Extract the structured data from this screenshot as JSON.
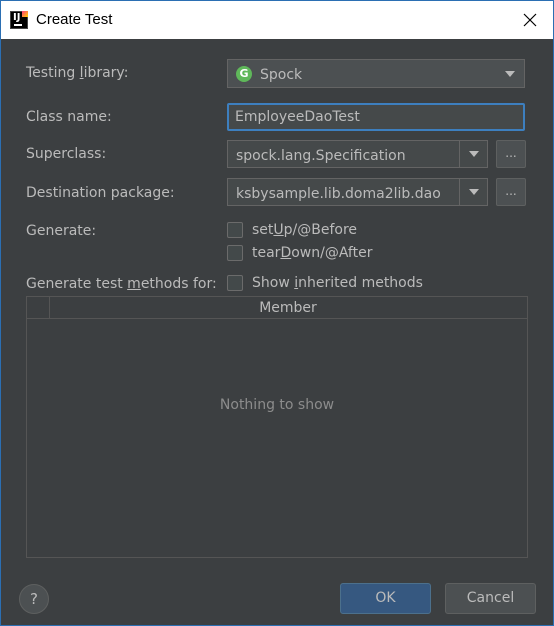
{
  "window": {
    "title": "Create Test"
  },
  "labels": {
    "testing_library_pre": "Testing ",
    "testing_library_u": "l",
    "testing_library_post": "ibrary:",
    "class_name": "Class name:",
    "superclass": "Superclass:",
    "destination_package": "Destination package:",
    "generate": "Generate:",
    "generate_methods_pre": "Generate test ",
    "generate_methods_u": "m",
    "generate_methods_post": "ethods for:"
  },
  "testing_library": {
    "value": "Spock",
    "icon_letter": "G",
    "icon_color": "#5fb85a"
  },
  "class_name": {
    "value": "EmployeeDaoTest"
  },
  "superclass": {
    "value": "spock.lang.Specification",
    "browse": "..."
  },
  "destination_package": {
    "value": "ksbysample.lib.doma2lib.dao",
    "browse": "..."
  },
  "checkboxes": {
    "setup_pre": "set",
    "setup_u": "U",
    "setup_post": "p/@Before",
    "teardown_pre": "tear",
    "teardown_u": "D",
    "teardown_post": "own/@After",
    "inherited_pre": "Show ",
    "inherited_u": "i",
    "inherited_post": "nherited methods"
  },
  "table": {
    "column": "Member",
    "empty_text": "Nothing to show"
  },
  "buttons": {
    "help": "?",
    "ok": "OK",
    "cancel": "Cancel"
  },
  "colors": {
    "background": "#3c3f41",
    "accent_focus": "#3d7fbf",
    "ok_button": "#365880"
  }
}
